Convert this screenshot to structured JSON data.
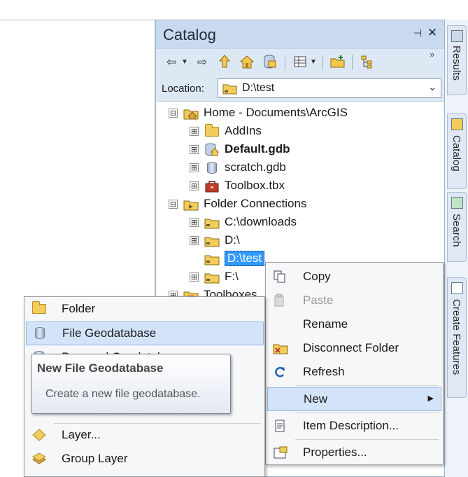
{
  "catalog": {
    "title": "Catalog",
    "pin_icon": "pin-icon",
    "close_icon": "close-icon",
    "more_label": "»"
  },
  "toolbar": {
    "buttons": [
      "back-icon",
      "dropdown-arrow-icon",
      "forward-icon",
      "up-folder-icon",
      "home-icon",
      "toggle-contents-icon",
      "view-options-icon",
      "connect-folder-icon",
      "tree-options-icon"
    ]
  },
  "location": {
    "label": "Location:",
    "value": "D:\\test"
  },
  "tree": {
    "items": [
      {
        "label": "Home - Documents\\ArcGIS",
        "icon": "home-folder-icon",
        "expander": "⊟"
      },
      {
        "label": "AddIns",
        "icon": "folder-icon",
        "expander": "⊞"
      },
      {
        "label": "Default.gdb",
        "icon": "default-geodatabase-icon",
        "expander": "⊞"
      },
      {
        "label": "scratch.gdb",
        "icon": "geodatabase-icon",
        "expander": "⊞"
      },
      {
        "label": "Toolbox.tbx",
        "icon": "toolbox-icon",
        "expander": "⊞"
      },
      {
        "label": "Folder Connections",
        "icon": "folder-connections-icon",
        "expander": "⊟"
      },
      {
        "label": "C:\\downloads",
        "icon": "folder-connection-icon",
        "expander": "⊞"
      },
      {
        "label": "D:\\",
        "icon": "folder-connection-icon",
        "expander": "⊞"
      },
      {
        "label": "D:\\test",
        "icon": "folder-connection-icon",
        "expander": ""
      },
      {
        "label": "F:\\",
        "icon": "folder-connection-icon",
        "expander": "⊞"
      },
      {
        "label": "Toolboxes",
        "icon": "toolboxes-icon",
        "expander": "⊞"
      }
    ]
  },
  "context_menu": {
    "items": [
      {
        "label": "Copy",
        "icon": "copy-icon",
        "enabled": true
      },
      {
        "label": "Paste",
        "icon": "paste-icon",
        "enabled": false
      },
      {
        "label": "Rename",
        "icon": "",
        "enabled": true
      },
      {
        "label": "Disconnect Folder",
        "icon": "disconnect-folder-icon",
        "enabled": true
      },
      {
        "label": "Refresh",
        "icon": "refresh-icon",
        "enabled": true
      },
      {
        "label": "New",
        "icon": "",
        "enabled": true,
        "submenu_arrow": "▶"
      },
      {
        "label": "Item Description...",
        "icon": "item-description-icon",
        "enabled": true
      },
      {
        "label": "Properties...",
        "icon": "properties-icon",
        "enabled": true
      }
    ]
  },
  "submenu": {
    "items": [
      {
        "label": "Folder",
        "icon": "folder-icon"
      },
      {
        "label": "File Geodatabase",
        "icon": "file-geodatabase-icon"
      },
      {
        "label": "Personal Geodatabase",
        "icon": "personal-geodatabase-icon"
      },
      {
        "label": "Layer...",
        "icon": "layer-icon"
      },
      {
        "label": "Group Layer",
        "icon": "group-layer-icon"
      }
    ]
  },
  "tooltip": {
    "title": "New File Geodatabase",
    "body": "Create a new file geodatabase."
  },
  "side_tabs": [
    {
      "label": "Results",
      "icon": "results-icon"
    },
    {
      "label": "Catalog",
      "icon": "catalog-icon"
    },
    {
      "label": "Search",
      "icon": "search-icon"
    },
    {
      "label": "Create Features",
      "icon": "create-features-icon"
    }
  ]
}
